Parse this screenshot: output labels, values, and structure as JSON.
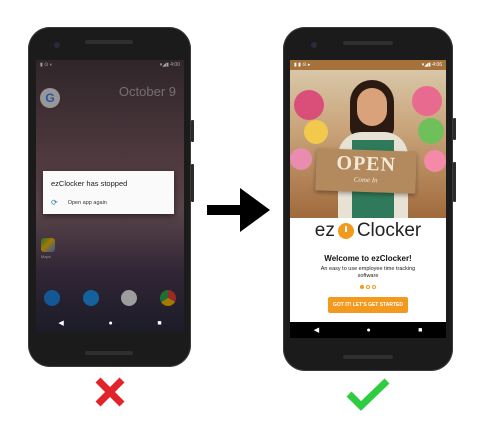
{
  "left_phone": {
    "status_time": "4:00",
    "date_text": "October 9",
    "dialog": {
      "title": "ezClocker has stopped",
      "action_label": "Open app again"
    },
    "maps_label": "Maps",
    "nav": [
      "◀",
      "●",
      "■"
    ]
  },
  "right_phone": {
    "status_time": "4:06",
    "sign": {
      "headline": "OPEN",
      "subline": "Come In"
    },
    "logo": {
      "left": "ez",
      "right": "Clocker"
    },
    "welcome": "Welcome to ezClocker!",
    "subtitle": "An easy to use employee time tracking software",
    "cta_label": "GOT IT! LET'S GET STARTED",
    "nav": [
      "◀",
      "●",
      "■"
    ]
  },
  "colors": {
    "accent": "#f39a1e",
    "fail": "#e0242a",
    "success": "#2ecc40",
    "arrow": "#000000"
  },
  "icons": [
    "refresh-icon",
    "arrow-right-icon",
    "x-mark-icon",
    "check-mark-icon"
  ]
}
